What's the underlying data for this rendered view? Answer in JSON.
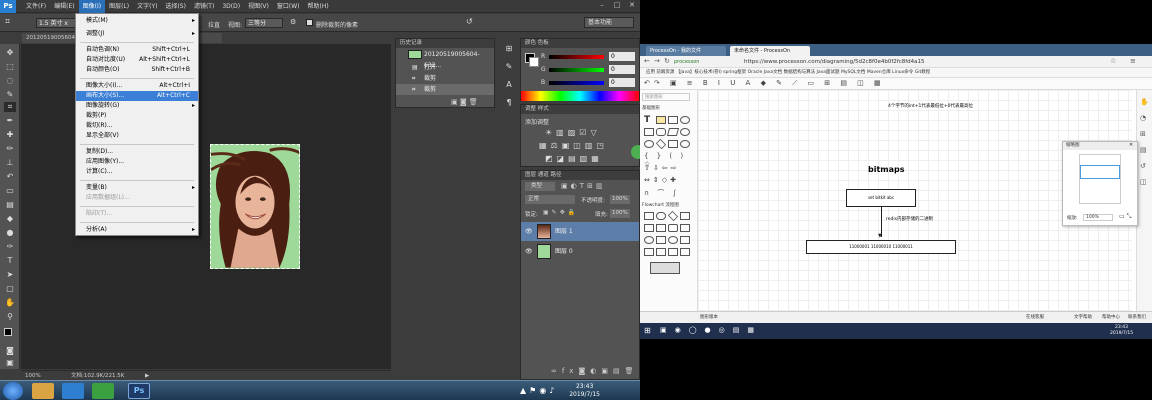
{
  "photoshop": {
    "menus": [
      "文件(F)",
      "编辑(E)",
      "图像(I)",
      "图层(L)",
      "文字(Y)",
      "选择(S)",
      "滤镜(T)",
      "3D(D)",
      "视图(V)",
      "窗口(W)",
      "帮助(H)"
    ],
    "options": {
      "ratio": "1.5 英寸 x",
      "straighten": "拉直",
      "view_label": "视图:",
      "view_value": "三等分",
      "delete_cropped": "删除裁剪的像素",
      "workspace": "基本功能"
    },
    "doc_tab": "20120519005604...",
    "image_menu": [
      {
        "label": "模式(M)",
        "shortcut": "",
        "arrow": true,
        "hl": false,
        "dis": false
      },
      {
        "label": "调整(J)",
        "shortcut": "",
        "arrow": true,
        "hl": false,
        "dis": false
      },
      {
        "label": "自动色调(N)",
        "shortcut": "Shift+Ctrl+L",
        "arrow": false,
        "hl": false,
        "dis": false
      },
      {
        "label": "自动对比度(U)",
        "shortcut": "Alt+Shift+Ctrl+L",
        "arrow": false,
        "hl": false,
        "dis": false
      },
      {
        "label": "自动颜色(O)",
        "shortcut": "Shift+Ctrl+B",
        "arrow": false,
        "hl": false,
        "dis": false
      },
      {
        "label": "图像大小(I)...",
        "shortcut": "Alt+Ctrl+I",
        "arrow": false,
        "hl": false,
        "dis": false
      },
      {
        "label": "画布大小(S)...",
        "shortcut": "Alt+Ctrl+C",
        "arrow": false,
        "hl": true,
        "dis": false
      },
      {
        "label": "图像旋转(G)",
        "shortcut": "",
        "arrow": true,
        "hl": false,
        "dis": false
      },
      {
        "label": "裁剪(P)",
        "shortcut": "",
        "arrow": false,
        "hl": false,
        "dis": false
      },
      {
        "label": "裁切(R)...",
        "shortcut": "",
        "arrow": false,
        "hl": false,
        "dis": false
      },
      {
        "label": "显示全部(V)",
        "shortcut": "",
        "arrow": false,
        "hl": false,
        "dis": false
      },
      {
        "label": "复制(D)...",
        "shortcut": "",
        "arrow": false,
        "hl": false,
        "dis": false
      },
      {
        "label": "应用图像(Y)...",
        "shortcut": "",
        "arrow": false,
        "hl": false,
        "dis": false
      },
      {
        "label": "计算(C)...",
        "shortcut": "",
        "arrow": false,
        "hl": false,
        "dis": false
      },
      {
        "label": "变量(B)",
        "shortcut": "",
        "arrow": true,
        "hl": false,
        "dis": false
      },
      {
        "label": "应用数据组(L)...",
        "shortcut": "",
        "arrow": false,
        "hl": false,
        "dis": true
      },
      {
        "label": "陷印(T)...",
        "shortcut": "",
        "arrow": false,
        "hl": false,
        "dis": true
      },
      {
        "label": "分析(A)",
        "shortcut": "",
        "arrow": true,
        "hl": false,
        "dis": false
      }
    ],
    "history": {
      "tab": "历史记录",
      "snapshot": "20120519005604-632...",
      "rows": [
        "打开",
        "裁剪",
        "裁剪"
      ]
    },
    "color": {
      "tabs": "颜色   色板",
      "r": "R",
      "g": "G",
      "b": "B",
      "r_val": "0",
      "g_val": "0",
      "b_val": "0"
    },
    "adjust": {
      "tabs": "调整   样式",
      "title": "添加调整"
    },
    "layers": {
      "tabs": "图层   通道   路径",
      "kind": "类型",
      "blend": "正常",
      "opacity_label": "不透明度:",
      "opacity": "100%",
      "lock_label": "锁定:",
      "fill_label": "填充:",
      "fill": "100%",
      "items": [
        "图层 1",
        "图层 0"
      ]
    },
    "status": {
      "zoom": "100%",
      "doc": "文档:102.9K/221.5K"
    }
  },
  "taskbar": {
    "time": "23:43",
    "date": "2019/7/15"
  },
  "browser": {
    "tabs": [
      "ProcessOn - 我的文件",
      "未命名文件 - ProcessOn"
    ],
    "url": "https://www.processon.com/diagraming/5d2c8f0e4b0f2fc8fd4a15",
    "secure": "processon",
    "bookmarks": "应用   前端资源   【Java】核心技术(卷I)   spring框架   Oracle Java文档   数据结构与算法   Java面试题   MySQL文档   Maven仓库   Linux命令   Git教程",
    "sidebar_search": "搜索图形",
    "sidebar_section": "基础图形",
    "sidebar_section2": "Flowchart 流程图",
    "more_shapes": "更多图形",
    "diagram": {
      "note": "4个字节的int+1代表最低位+0代表最高位",
      "title": "bitmaps",
      "box1": "set  bitkit  abc",
      "arrow_label": "redis内部存储的二进制",
      "box2": "11000001 11000010 11000011"
    },
    "navigator": {
      "title": "缩略图",
      "zoom": "缩放:",
      "zoom_val": "100%"
    },
    "status_left": "图形版本",
    "status_right": [
      "在线客服",
      "文字帮助",
      "帮助中心",
      "联系我们"
    ]
  },
  "colors": {
    "ps_bg": "#3c3c3c",
    "menu_highlight": "#3c7fd6",
    "layer_selected": "#5d7ea8",
    "image_bg_green": "#9fd99a"
  }
}
